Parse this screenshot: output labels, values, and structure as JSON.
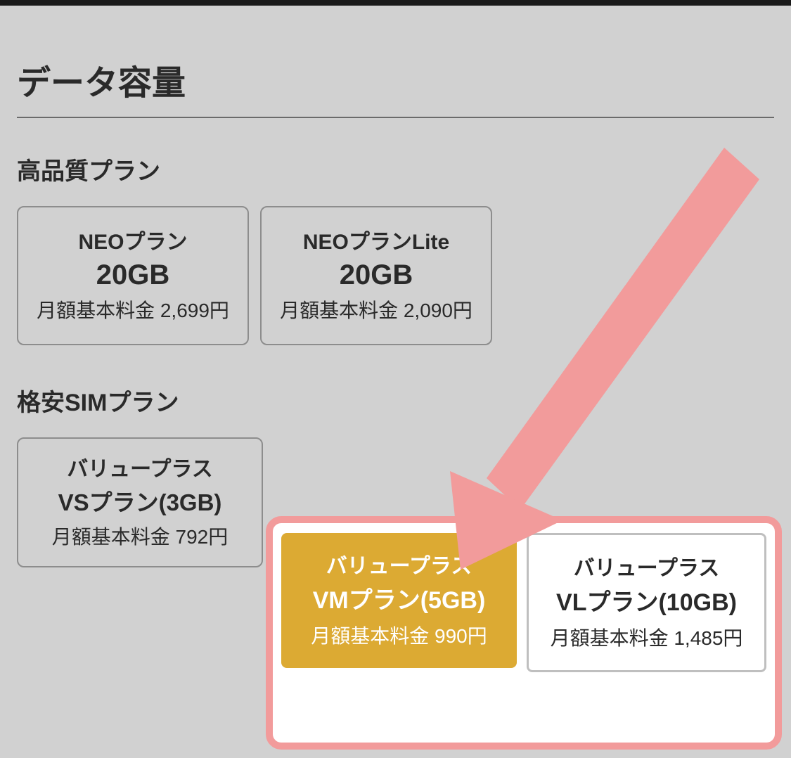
{
  "section_title": "データ容量",
  "groups": {
    "premium": {
      "title": "高品質プラン",
      "cards": [
        {
          "name": "NEOプラン",
          "size": "20GB",
          "price": "月額基本料金 2,699円"
        },
        {
          "name": "NEOプランLite",
          "size": "20GB",
          "price": "月額基本料金 2,090円"
        }
      ]
    },
    "budget": {
      "title": "格安SIMプラン",
      "cards": [
        {
          "top": "バリュープラス",
          "main": "VSプラン(3GB)",
          "price": "月額基本料金 792円"
        },
        {
          "top": "バリュープラス",
          "main": "VMプラン(5GB)",
          "price": "月額基本料金 990円",
          "selected": true
        },
        {
          "top": "バリュープラス",
          "main": "VLプラン(10GB)",
          "price": "月額基本料金 1,485円"
        }
      ]
    }
  },
  "colors": {
    "highlight_border": "#f29b9b",
    "selected_bg": "#dcaa33",
    "arrow": "#f29b9b"
  }
}
